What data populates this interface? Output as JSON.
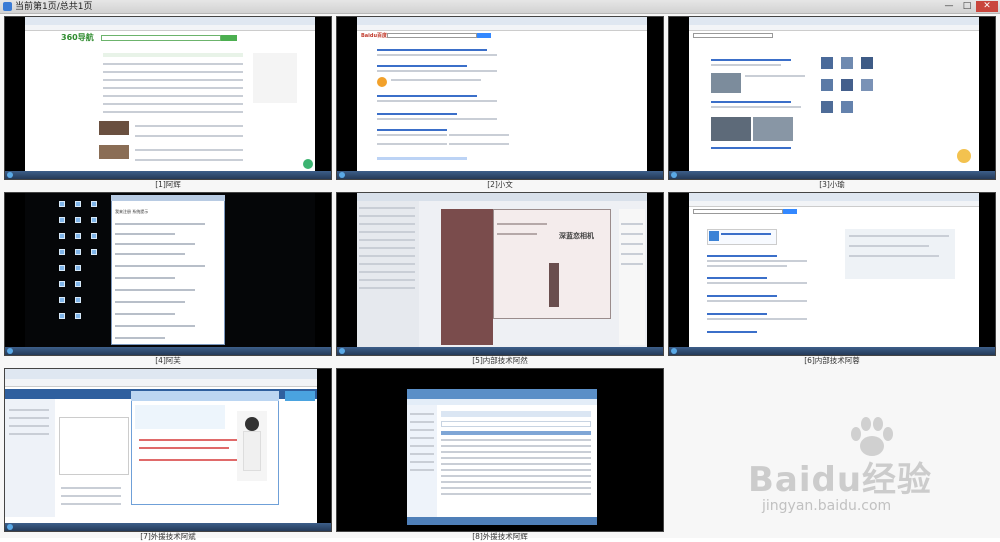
{
  "window": {
    "title": "当前第1页/总共1页",
    "min": "—",
    "max": "□",
    "close": "✕"
  },
  "thumbnails": [
    {
      "caption": "[1]阿辉"
    },
    {
      "caption": "[2]小文"
    },
    {
      "caption": "[3]小瑜"
    },
    {
      "caption": "[4]阿芙"
    },
    {
      "caption": "[5]内部技术阿然"
    },
    {
      "caption": "[6]内部技术阿蓉"
    },
    {
      "caption": "[7]外援技术阿斌"
    },
    {
      "caption": "[8]外援技术阿辉"
    }
  ],
  "content": {
    "site_360_logo": "360导航",
    "baidu_logo": "Baidu百度",
    "chat_banner": "深蓝恋相机",
    "desktop_log_header": "我来注册 系统提示"
  },
  "watermark": {
    "brand": "Baidu经验",
    "url": "jingyan.baidu.com"
  }
}
